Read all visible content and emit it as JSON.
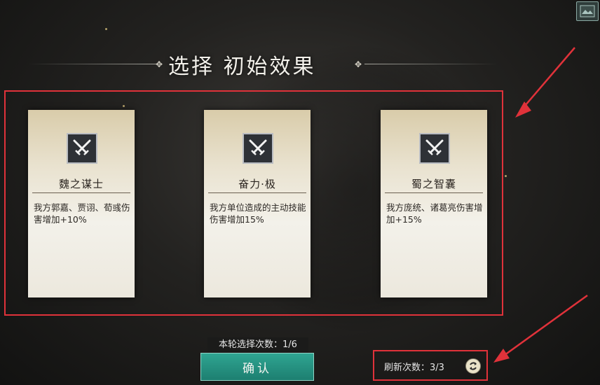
{
  "title": "选择 初始效果",
  "cards": [
    {
      "name": "魏之谋士",
      "desc": "我方郭嘉、贾诩、荀彧伤害增加+10%",
      "icon": "crossed-swords-icon"
    },
    {
      "name": "奋力·极",
      "desc": "我方单位造成的主动技能伤害增加15%",
      "icon": "crossed-swords-icon"
    },
    {
      "name": "蜀之智囊",
      "desc": "我方庞统、诸葛亮伤害增加+15%",
      "icon": "crossed-swords-icon"
    }
  ],
  "selection_count": "本轮选择次数：1/6",
  "confirm_label": "确认",
  "refresh_count": "刷新次数：3/3",
  "colors": {
    "confirm": "#1d7f70",
    "highlight": "#e0323a",
    "arrow": "#e0323a"
  }
}
